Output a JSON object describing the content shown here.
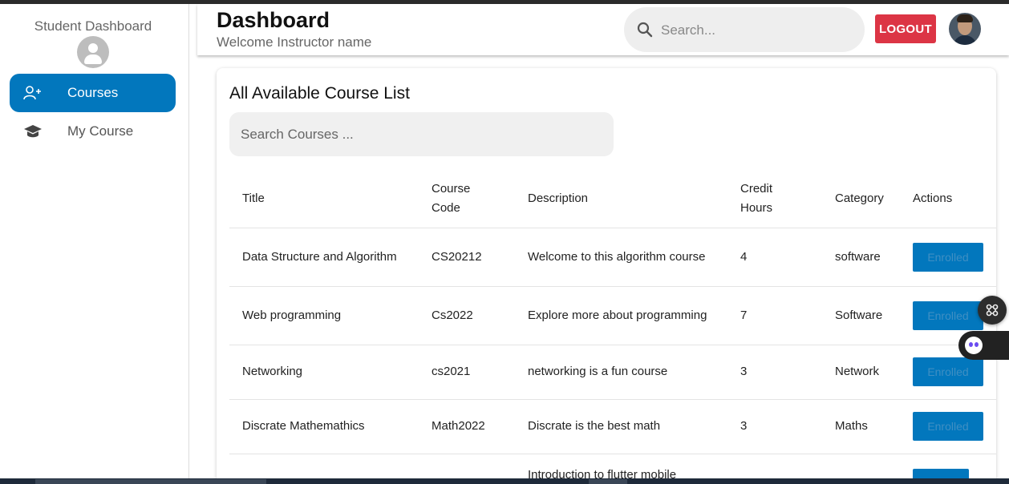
{
  "colors": {
    "accent": "#0277bd",
    "logout": "#dc3545",
    "sidebar_active_text": "#ffffff"
  },
  "sidebar": {
    "title": "Student Dashboard",
    "avatar_icon": "user-avatar-icon",
    "items": [
      {
        "label": "Courses",
        "icon": "add-user-icon",
        "active": true
      },
      {
        "label": "My Course",
        "icon": "graduation-cap-icon",
        "active": false
      }
    ]
  },
  "header": {
    "title": "Dashboard",
    "subtitle": "Welcome Instructor name",
    "search_placeholder": "Search...",
    "logout_label": "LOGOUT"
  },
  "main": {
    "title": "All Available Course List",
    "search_placeholder": "Search Courses ...",
    "table": {
      "headers": {
        "title": "Title",
        "code_line1": "Course",
        "code_line2": "Code",
        "description": "Description",
        "credit_line1": "Credit",
        "credit_line2": "Hours",
        "category": "Category",
        "actions": "Actions"
      },
      "rows": [
        {
          "title": "Data Structure and Algorithm",
          "code": "CS20212",
          "description": "Welcome to this algorithm course",
          "credit": "4",
          "category": "software",
          "action": "Enrolled"
        },
        {
          "title": "Web programming",
          "code": "Cs2022",
          "description": "Explore more about programming",
          "credit": "7",
          "category": "Software",
          "action": "Enrolled"
        },
        {
          "title": "Networking",
          "code": "cs2021",
          "description": "networking is a fun course",
          "credit": "3",
          "category": "Network",
          "action": "Enrolled"
        },
        {
          "title": "Discrate Mathemathics",
          "code": "Math2022",
          "description": "Discrate is the best math",
          "credit": "3",
          "category": "Maths",
          "action": "Enrolled"
        },
        {
          "title": "",
          "code": "",
          "description": "Introduction to flutter mobile",
          "credit": "",
          "category": "",
          "action": ""
        }
      ]
    }
  }
}
